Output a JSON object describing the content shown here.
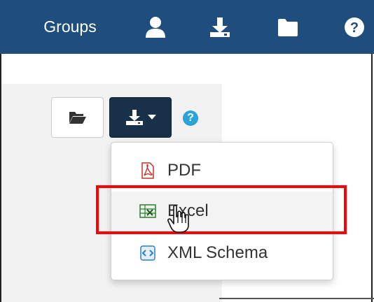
{
  "topbar": {
    "groups_label": "Groups",
    "icons": [
      "user-icon",
      "download-icon",
      "folder-icon",
      "help-icon"
    ]
  },
  "toolbar": {
    "help_glyph": "?"
  },
  "download_menu": {
    "items": [
      {
        "label": "PDF",
        "icon": "pdf-icon"
      },
      {
        "label": "Excel",
        "icon": "excel-icon"
      },
      {
        "label": "XML Schema",
        "icon": "xml-schema-icon"
      }
    ]
  },
  "colors": {
    "topbar": "#1f4d7d",
    "download_button": "#183148",
    "help": "#2aa3d8",
    "highlight": "#ff0000"
  }
}
